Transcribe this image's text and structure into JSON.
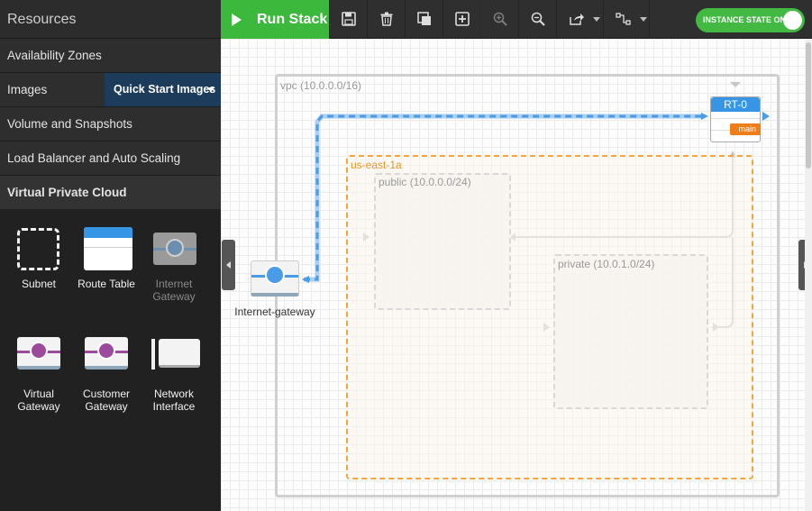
{
  "sidebar": {
    "header": "Resources",
    "sections": [
      {
        "label": "Availability Zones"
      },
      {
        "label": "Images"
      },
      {
        "label": "Volume and Snapshots"
      },
      {
        "label": "Load Balancer and Auto Scaling"
      },
      {
        "label": "Virtual Private Cloud"
      }
    ],
    "quickstart_label": "Quick Start Images",
    "palette": [
      {
        "label": "Subnet",
        "icon": "subnet-icon"
      },
      {
        "label": "Route Table",
        "icon": "route-table-icon"
      },
      {
        "label": "Internet Gateway",
        "icon": "internet-gateway-icon"
      },
      {
        "label": "Virtual Gateway",
        "icon": "virtual-gateway-icon"
      },
      {
        "label": "Customer Gateway",
        "icon": "customer-gateway-icon"
      },
      {
        "label": "Network Interface",
        "icon": "network-interface-icon"
      }
    ]
  },
  "toolbar": {
    "run_label": "Run Stack",
    "instance_state_label": "INSTANCE STATE ON",
    "colors": {
      "run": "#3cb93c",
      "toggle": "#43b843"
    }
  },
  "canvas": {
    "vpc_label": "vpc (10.0.0.0/16)",
    "az_label": "us-east-1a",
    "public_label": "public (10.0.0.0/24)",
    "private_label": "private (10.0.1.0/24)",
    "rt_label": "RT-0",
    "rt_badge": "main",
    "igw_label": "Internet-gateway",
    "colors": {
      "az": "#f3a63b",
      "link": "#5aa6f0",
      "rt": "#3795e6",
      "badge": "#ef7d1a"
    }
  }
}
